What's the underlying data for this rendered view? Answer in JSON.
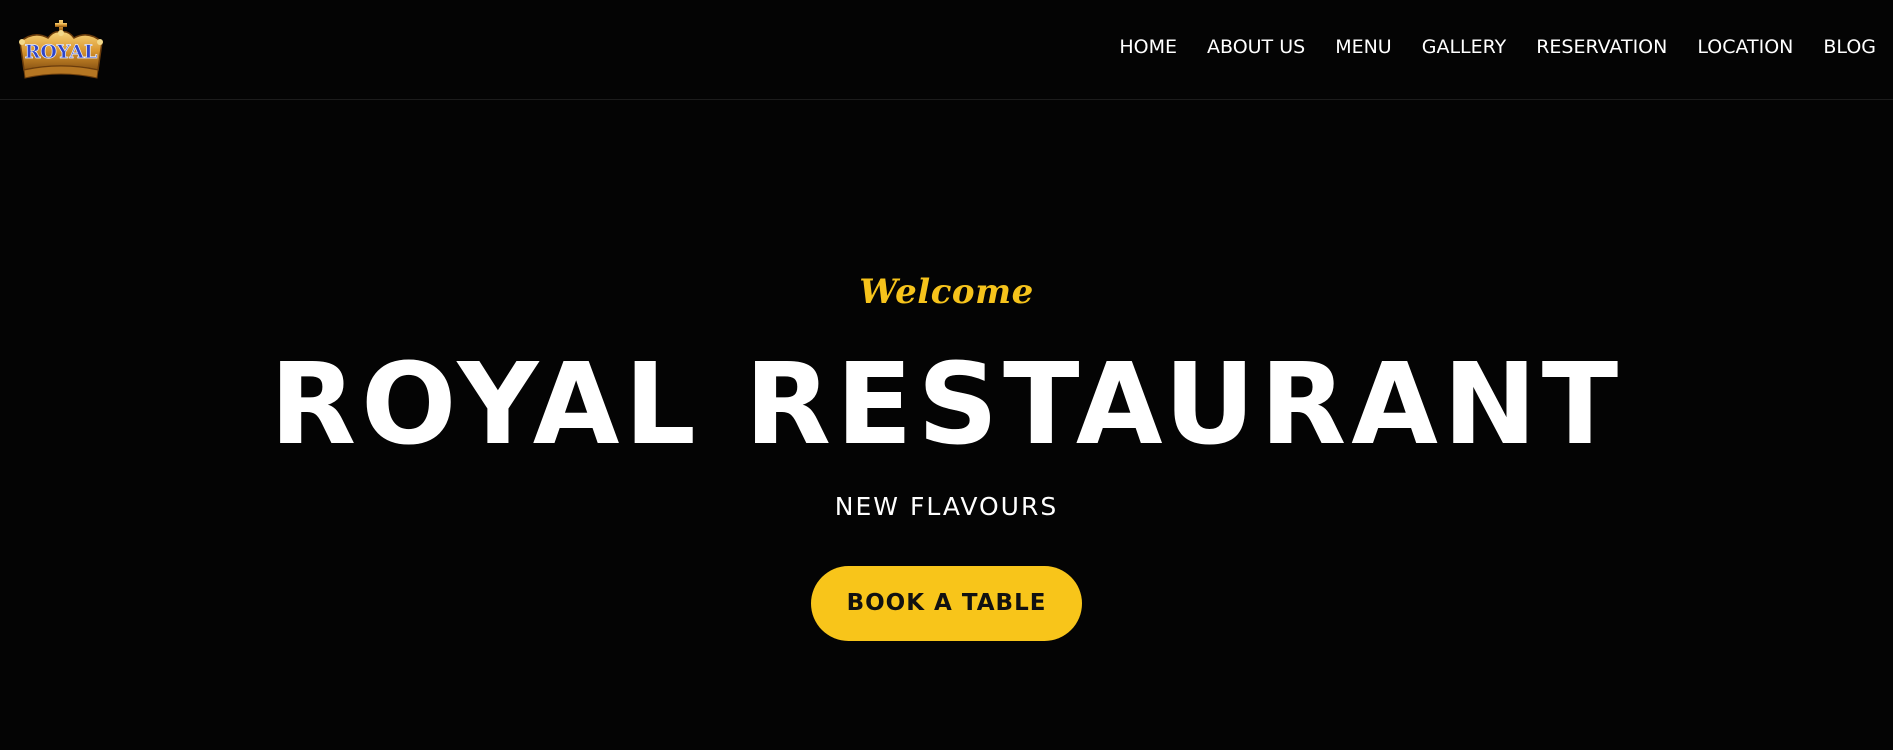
{
  "header": {
    "logo": {
      "text": "ROYAL",
      "icon": "crown-logo-icon"
    },
    "nav": [
      {
        "label": "HOME"
      },
      {
        "label": "ABOUT US"
      },
      {
        "label": "MENU"
      },
      {
        "label": "GALLERY"
      },
      {
        "label": "RESERVATION"
      },
      {
        "label": "LOCATION"
      },
      {
        "label": "BLOG"
      }
    ]
  },
  "hero": {
    "welcome": "Welcome",
    "title": "ROYAL RESTAURANT",
    "subtitle": "NEW FLAVOURS",
    "cta_label": "BOOK A TABLE"
  },
  "colors": {
    "background": "#040404",
    "accent": "#f8c51a",
    "text": "#ffffff",
    "logo_gold": "#d9962f",
    "logo_blue": "#2f45c8"
  }
}
